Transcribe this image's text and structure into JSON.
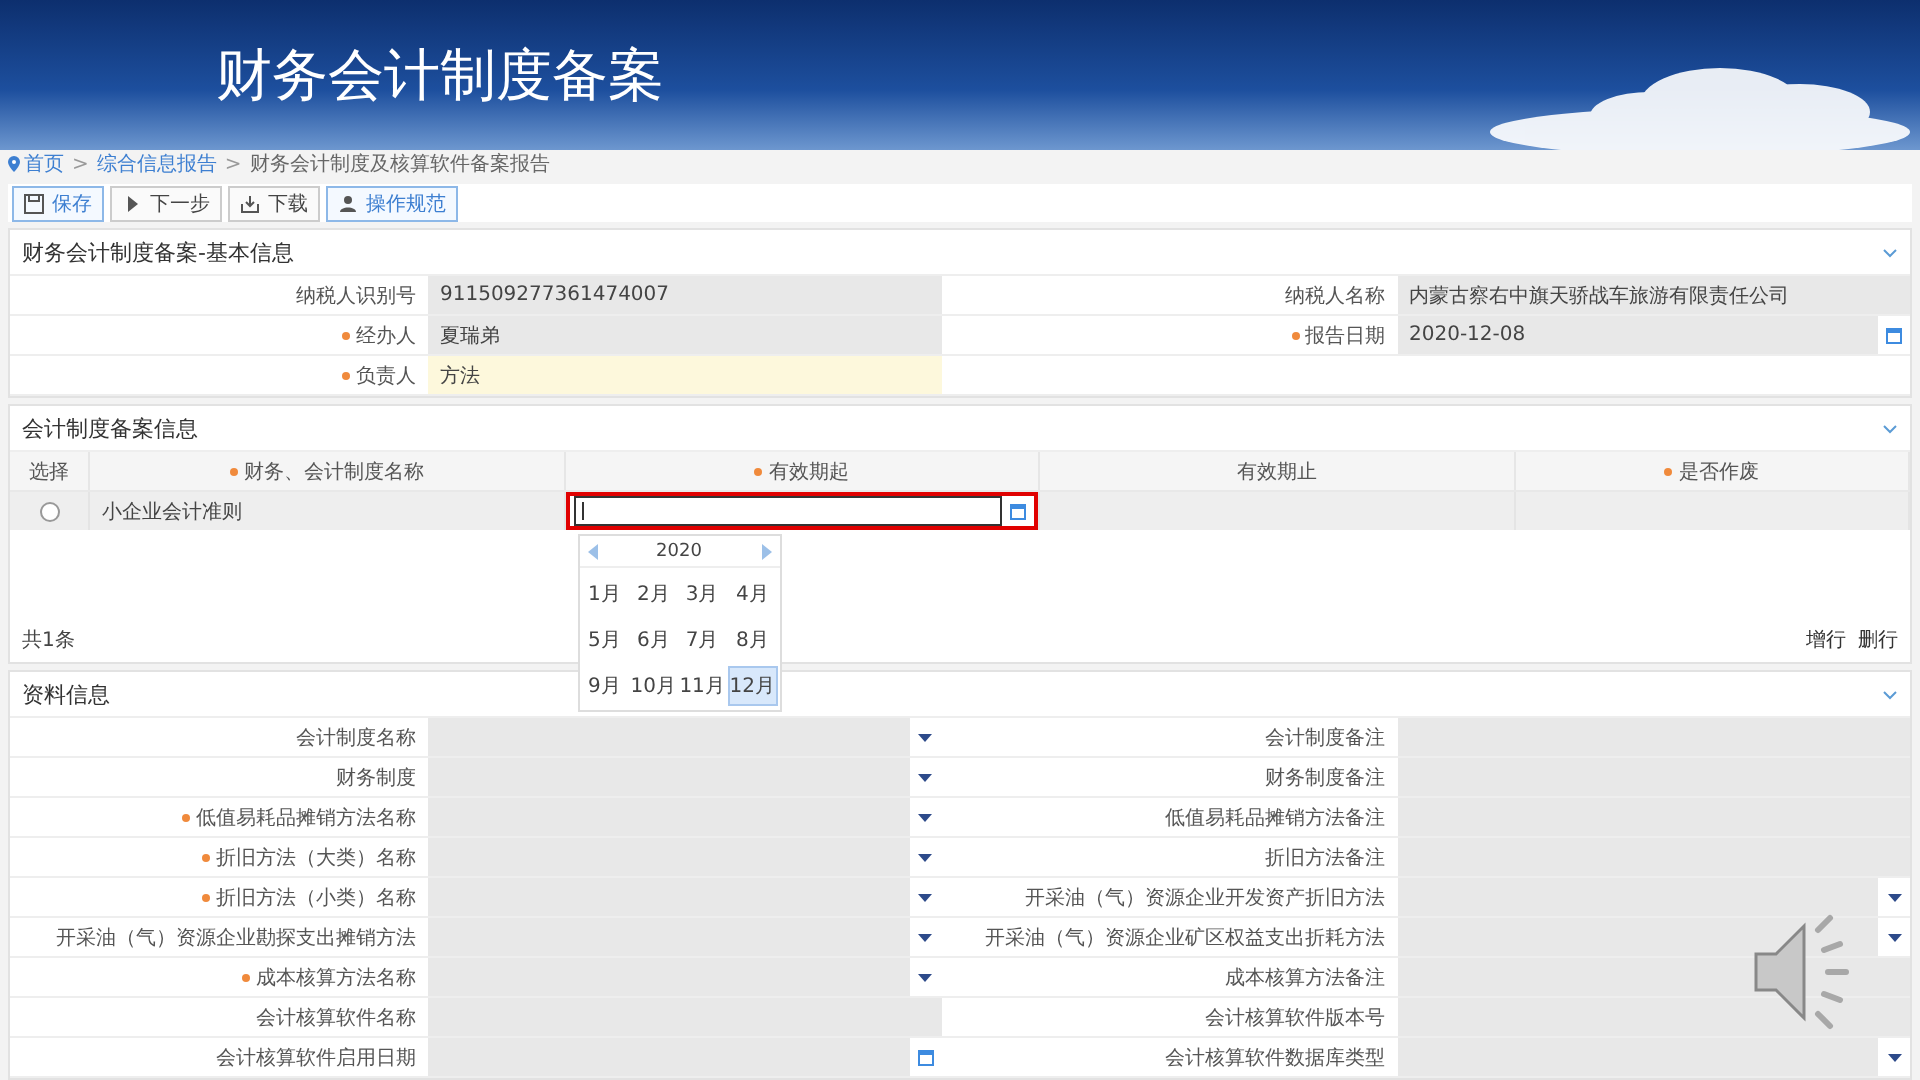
{
  "slide_title": "财务会计制度备案",
  "breadcrumb": [
    {
      "label": "首页",
      "kind": "home"
    },
    {
      "label": ">",
      "kind": "separator"
    },
    {
      "label": "综合信息报告",
      "kind": "link"
    },
    {
      "label": ">",
      "kind": "separator"
    },
    {
      "label": "财务会计制度及核算软件备案报告",
      "kind": "current"
    }
  ],
  "toolbar": [
    {
      "label": "保存",
      "kind": "save",
      "highlighted": true
    },
    {
      "label": "下一步",
      "kind": "next",
      "highlighted": false
    },
    {
      "label": "下载",
      "kind": "download",
      "highlighted": false
    },
    {
      "label": "操作规范",
      "kind": "guide",
      "highlighted": true
    }
  ],
  "basic_info": {
    "title": "财务会计制度备案-基本信息",
    "rows": [
      [
        {
          "label": "纳税人识别号",
          "required": false,
          "value": "911509277361474007",
          "kind": "readonly"
        },
        {
          "label": "纳税人名称",
          "required": false,
          "value": "内蒙古察右中旗天骄战车旅游有限责任公司",
          "kind": "readonly"
        }
      ],
      [
        {
          "label": "经办人",
          "required": true,
          "value": "夏瑞弟",
          "kind": "readonly"
        },
        {
          "label": "报告日期",
          "required": true,
          "value": "2020-12-08",
          "kind": "date"
        }
      ],
      [
        {
          "label": "负责人",
          "required": true,
          "value": "方法",
          "kind": "input"
        }
      ]
    ]
  },
  "filing_info": {
    "title": "会计制度备案信息",
    "columns": [
      {
        "label": "选择",
        "required": false
      },
      {
        "label": "财务、会计制度名称",
        "required": true
      },
      {
        "label": "有效期起",
        "required": true
      },
      {
        "label": "有效期止",
        "required": false
      },
      {
        "label": "是否作废",
        "required": true
      }
    ],
    "rows": [
      {
        "selected": false,
        "name": "小企业会计准则"
      }
    ],
    "date_editor": {
      "highlighted": true,
      "year": "2020",
      "months": [
        {
          "label": "1月",
          "selected": false
        },
        {
          "label": "2月",
          "selected": false
        },
        {
          "label": "3月",
          "selected": false
        },
        {
          "label": "4月",
          "selected": false
        },
        {
          "label": "5月",
          "selected": false
        },
        {
          "label": "6月",
          "selected": false
        },
        {
          "label": "7月",
          "selected": false
        },
        {
          "label": "8月",
          "selected": false
        },
        {
          "label": "9月",
          "selected": false
        },
        {
          "label": "10月",
          "selected": false
        },
        {
          "label": "11月",
          "selected": false
        },
        {
          "label": "12月",
          "selected": true
        }
      ]
    },
    "total": "共1条",
    "actions": [
      "增行",
      "删行"
    ]
  },
  "material_info": {
    "title": "资料信息",
    "rows": [
      [
        {
          "label": "会计制度名称",
          "required": false,
          "kind": "select"
        },
        {
          "label": "会计制度备注",
          "required": false,
          "kind": "readonly"
        }
      ],
      [
        {
          "label": "财务制度",
          "required": false,
          "kind": "select"
        },
        {
          "label": "财务制度备注",
          "required": false,
          "kind": "readonly"
        }
      ],
      [
        {
          "label": "低值易耗品摊销方法名称",
          "required": true,
          "kind": "select"
        },
        {
          "label": "低值易耗品摊销方法备注",
          "required": false,
          "kind": "readonly"
        }
      ],
      [
        {
          "label": "折旧方法（大类）名称",
          "required": true,
          "kind": "select"
        },
        {
          "label": "折旧方法备注",
          "required": false,
          "kind": "readonly"
        }
      ],
      [
        {
          "label": "折旧方法（小类）名称",
          "required": true,
          "kind": "select"
        },
        {
          "label": "开采油（气）资源企业开发资产折旧方法",
          "required": false,
          "kind": "select"
        }
      ],
      [
        {
          "label": "开采油（气）资源企业勘探支出摊销方法",
          "required": false,
          "kind": "select"
        },
        {
          "label": "开采油（气）资源企业矿区权益支出折耗方法",
          "required": false,
          "kind": "select"
        }
      ],
      [
        {
          "label": "成本核算方法名称",
          "required": true,
          "kind": "select"
        },
        {
          "label": "成本核算方法备注",
          "required": false,
          "kind": "readonly"
        }
      ],
      [
        {
          "label": "会计核算软件名称",
          "required": false,
          "kind": "readonly"
        },
        {
          "label": "会计核算软件版本号",
          "required": false,
          "kind": "readonly"
        }
      ],
      [
        {
          "label": "会计核算软件启用日期",
          "required": false,
          "kind": "date"
        },
        {
          "label": "会计核算软件数据库类型",
          "required": false,
          "kind": "select"
        }
      ]
    ]
  }
}
